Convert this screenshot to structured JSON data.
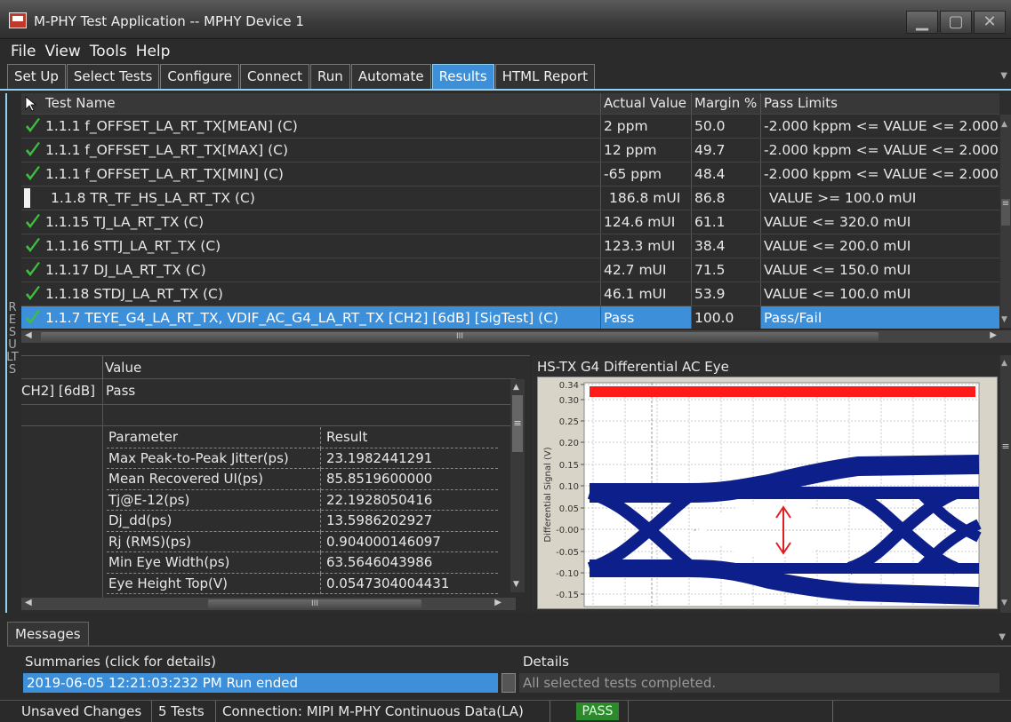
{
  "window": {
    "title": "M-PHY Test Application -- MPHY Device 1"
  },
  "menu": [
    "File",
    "View",
    "Tools",
    "Help"
  ],
  "tabs": [
    {
      "label": "Set Up",
      "active": false
    },
    {
      "label": "Select Tests",
      "active": false
    },
    {
      "label": "Configure",
      "active": false
    },
    {
      "label": "Connect",
      "active": false
    },
    {
      "label": "Run",
      "active": false
    },
    {
      "label": "Automate",
      "active": false
    },
    {
      "label": "Results",
      "active": true
    },
    {
      "label": "HTML Report",
      "active": false
    }
  ],
  "side_label": "RESULTS",
  "results": {
    "columns": {
      "name": "Test Name",
      "actual": "Actual Value",
      "margin": "Margin %",
      "limits": "Pass Limits"
    },
    "rows": [
      {
        "name": "1.1.1 f_OFFSET_LA_RT_TX[MEAN] (C)",
        "actual": "2 ppm",
        "margin": "50.0",
        "limits": "-2.000 kppm <= VALUE <= 2.000",
        "status": "pass"
      },
      {
        "name": "1.1.1 f_OFFSET_LA_RT_TX[MAX] (C)",
        "actual": "12 ppm",
        "margin": "49.7",
        "limits": "-2.000 kppm <= VALUE <= 2.000",
        "status": "pass"
      },
      {
        "name": "1.1.1 f_OFFSET_LA_RT_TX[MIN] (C)",
        "actual": "-65 ppm",
        "margin": "48.4",
        "limits": "-2.000 kppm <= VALUE <= 2.000",
        "status": "pass"
      },
      {
        "name": "1.1.8 TR_TF_HS_LA_RT_TX (C)",
        "actual": "186.8 mUI",
        "margin": "86.8",
        "limits": "VALUE >= 100.0 mUI",
        "status": "info"
      },
      {
        "name": "1.1.15 TJ_LA_RT_TX (C)",
        "actual": "124.6 mUI",
        "margin": "61.1",
        "limits": "VALUE <= 320.0 mUI",
        "status": "pass"
      },
      {
        "name": "1.1.16 STTJ_LA_RT_TX (C)",
        "actual": "123.3 mUI",
        "margin": "38.4",
        "limits": "VALUE <= 200.0 mUI",
        "status": "pass"
      },
      {
        "name": "1.1.17 DJ_LA_RT_TX (C)",
        "actual": "42.7 mUI",
        "margin": "71.5",
        "limits": "VALUE <= 150.0 mUI",
        "status": "pass"
      },
      {
        "name": "1.1.18 STDJ_LA_RT_TX (C)",
        "actual": "46.1 mUI",
        "margin": "53.9",
        "limits": "VALUE <= 100.0 mUI",
        "status": "pass"
      },
      {
        "name": "1.1.7 TEYE_G4_LA_RT_TX, VDIF_AC_G4_LA_RT_TX [CH2] [6dB] [SigTest] (C)",
        "actual": "Pass",
        "margin": "100.0",
        "limits": "Pass/Fail",
        "status": "pass",
        "selected": true
      }
    ],
    "hscroll_label": "III"
  },
  "detail": {
    "value_header": "Value",
    "test_fragment": "CH2] [6dB]",
    "test_value": "Pass",
    "param_header": "Parameter",
    "result_header": "Result",
    "params": [
      {
        "name": "Max Peak-to-Peak Jitter(ps)",
        "value": "23.1982441291"
      },
      {
        "name": "Mean Recovered UI(ps)",
        "value": "85.8519600000"
      },
      {
        "name": "Tj@E-12(ps)",
        "value": "22.1928050416"
      },
      {
        "name": "Dj_dd(ps)",
        "value": "13.5986202927"
      },
      {
        "name": "Rj (RMS)(ps)",
        "value": "0.904000146097"
      },
      {
        "name": "Min Eye Width(ps)",
        "value": "63.5646043986"
      },
      {
        "name": "Eye Height Top(V)",
        "value": "0.0547304004431"
      }
    ],
    "hscroll_label": "III"
  },
  "eye": {
    "title": "HS-TX G4 Differential AC Eye",
    "ylabel": "Differential Signal (V)",
    "yticks": [
      "0.34",
      "0.30",
      "0.25",
      "0.20",
      "0.15",
      "0.10",
      "0.05",
      "-0.00",
      "-0.05",
      "-0.10",
      "-0.15"
    ]
  },
  "messages": {
    "tab": "Messages",
    "summaries_header": "Summaries (click for details)",
    "details_header": "Details",
    "summary": "2019-06-05 12:21:03:232 PM Run ended",
    "detail": "All selected tests completed."
  },
  "status": {
    "unsaved": "Unsaved Changes",
    "tests": "5 Tests",
    "connection": "Connection: MIPI M-PHY Continuous Data(LA)",
    "result": "PASS"
  },
  "colors": {
    "accent": "#3c8fd8",
    "pass_check": "#3fbf3f",
    "eye_trace": "#0d1f8a",
    "limit_band": "#ff1a1a"
  }
}
